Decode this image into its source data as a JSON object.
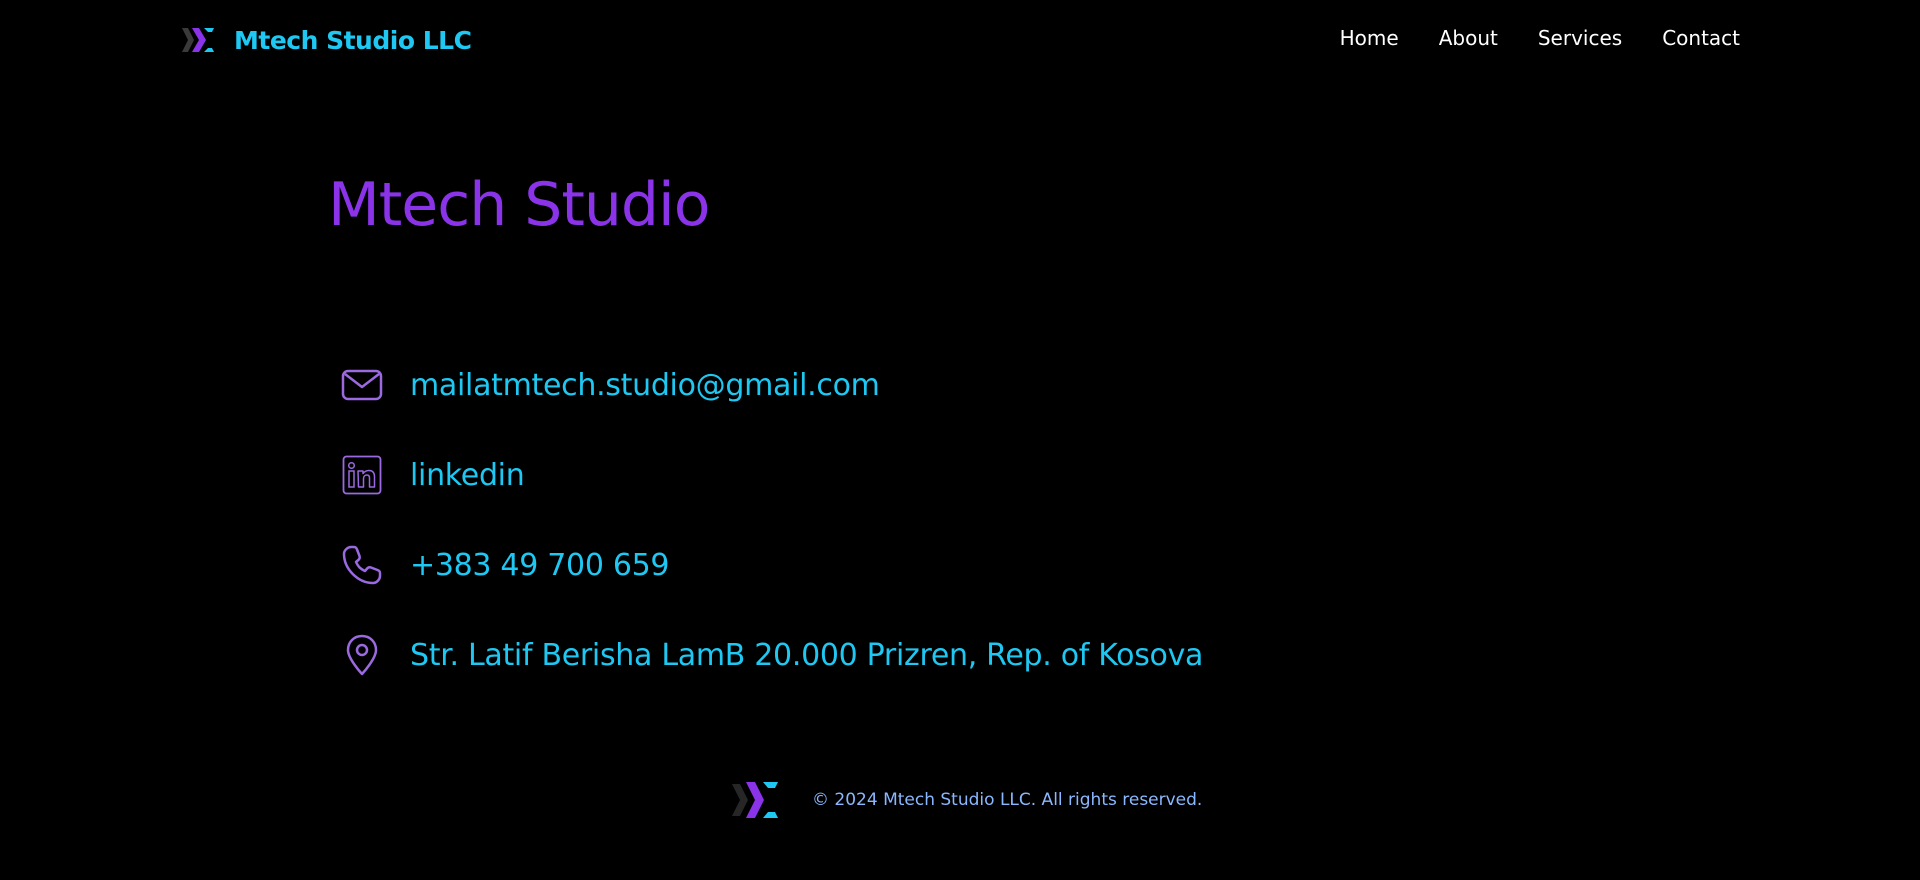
{
  "header": {
    "brand_name": "Mtech Studio LLC",
    "nav": [
      {
        "label": "Home"
      },
      {
        "label": "About"
      },
      {
        "label": "Services"
      },
      {
        "label": "Contact"
      }
    ]
  },
  "main": {
    "title": "Mtech Studio",
    "contacts": [
      {
        "icon": "mail-icon",
        "text": "mailatmtech.studio@gmail.com"
      },
      {
        "icon": "linkedin-icon",
        "text": "linkedin"
      },
      {
        "icon": "phone-icon",
        "text": "+383 49 700 659"
      },
      {
        "icon": "location-pin-icon",
        "text": "Str. Latif Berisha LamB 20.000 Prizren, Rep. of Kosova"
      }
    ]
  },
  "footer": {
    "copyright": "© 2024 Mtech Studio LLC. All rights reserved."
  },
  "colors": {
    "background": "#000000",
    "brand_cyan": "#1ec8f2",
    "accent_purple": "#8a33e8",
    "icon_purple": "#9b6ae0",
    "footer_text": "#8ab8ff",
    "nav_text": "#ffffff"
  }
}
